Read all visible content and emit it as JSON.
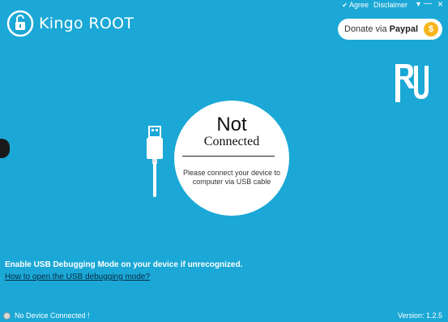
{
  "app": {
    "brand_prefix": "Kingo",
    "brand_suffix": "ROOT"
  },
  "topbar": {
    "agree_label": "Agree",
    "disclaimer_label": "Disclaimer",
    "minimize_glyph": "▾",
    "menu_glyph": "—",
    "close_glyph": "×"
  },
  "donate": {
    "prefix": "Donate via",
    "brand": "Paypal",
    "coin_symbol": "$"
  },
  "side_logo_text": "RU",
  "status_circle": {
    "title": "Not",
    "subtitle": "Connected",
    "message": "Please connect your device to computer via USB cable"
  },
  "hints": {
    "enable_debug": "Enable USB Debugging Mode on your device if unrecognized.",
    "how_to_link": "How to open the USB debugging mode?"
  },
  "statusbar": {
    "device_status": "No Device Connected !",
    "version": "Version: 1.2.5"
  },
  "colors": {
    "background": "#1ba8d6",
    "coin": "#f6b51e",
    "link": "#0b2a44"
  }
}
